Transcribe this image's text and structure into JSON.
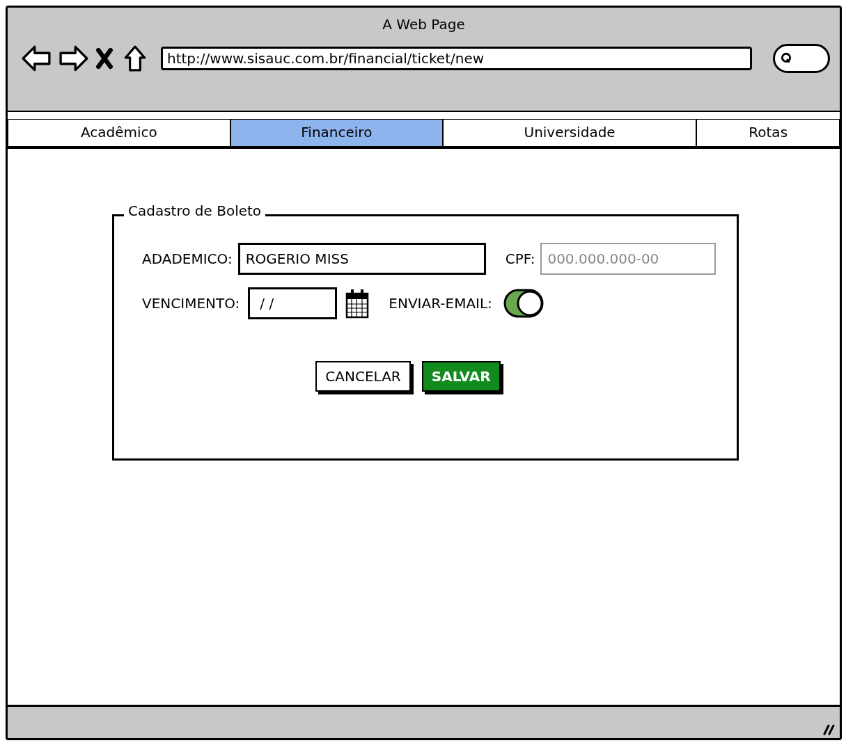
{
  "window": {
    "title": "A Web Page"
  },
  "address_bar": {
    "url": "http://www.sisauc.com.br/financial/ticket/new"
  },
  "tabs": [
    {
      "label": "Acadêmico",
      "selected": false
    },
    {
      "label": "Financeiro",
      "selected": true
    },
    {
      "label": "Universidade",
      "selected": false
    },
    {
      "label": "Rotas",
      "selected": false
    }
  ],
  "form": {
    "title": "Cadastro de Boleto",
    "academico": {
      "label": "ADADEMICO:",
      "value": "ROGERIO MISS"
    },
    "cpf": {
      "label": "CPF:",
      "placeholder": "000.000.000-00"
    },
    "vencimento": {
      "label": "VENCIMENTO:",
      "value": "/ /"
    },
    "enviar_email": {
      "label": "ENVIAR-EMAIL:",
      "on": true
    },
    "buttons": [
      {
        "label": "CANCELAR",
        "kind": "secondary"
      },
      {
        "label": "SALVAR",
        "kind": "primary"
      }
    ]
  }
}
